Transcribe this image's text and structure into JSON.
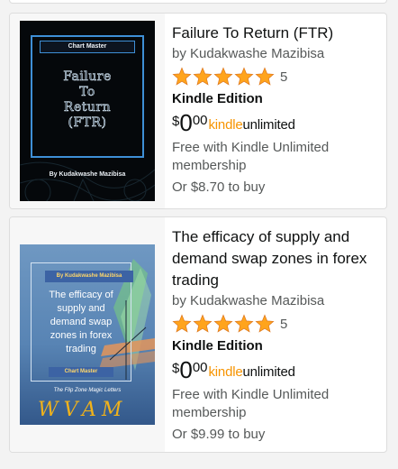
{
  "results": [
    {
      "title": "Failure To Return (FTR)",
      "author": "by Kudakwashe Mazibisa",
      "rating_count": "5",
      "rating_value": 5,
      "edition": "Kindle Edition",
      "price": {
        "currency": "$",
        "whole": "0",
        "fraction": "00"
      },
      "ku_logo": {
        "kindle": "kindle",
        "unlimited": "unlimited"
      },
      "offer_text": "Free with Kindle Unlimited membership",
      "buy_text": "Or $8.70 to buy",
      "cover": {
        "series": "Chart Master",
        "title_lines": [
          "Failure",
          "To",
          "Return",
          "(FTR)"
        ],
        "author": "By Kudakwashe Mazibisa"
      }
    },
    {
      "title": "The efficacy of supply and demand swap zones in forex trading",
      "author": "by Kudakwashe Mazibisa",
      "rating_count": "5",
      "rating_value": 5,
      "edition": "Kindle Edition",
      "price": {
        "currency": "$",
        "whole": "0",
        "fraction": "00"
      },
      "ku_logo": {
        "kindle": "kindle",
        "unlimited": "unlimited"
      },
      "offer_text": "Free with Kindle Unlimited membership",
      "buy_text": "Or $9.99 to buy",
      "cover": {
        "author_tag": "By Kudakwashe Mazibisa",
        "title_lines": [
          "The efficacy of",
          "supply and",
          "demand swap",
          "zones in forex",
          "trading"
        ],
        "series": "Chart Master",
        "tagline": "The Flip Zone Magic Letters",
        "magic_letters": "WVAM"
      }
    }
  ],
  "colors": {
    "page_bg": "#f3f3f3",
    "star": "#ffa41c",
    "kindle_orange": "#f79400",
    "secondary_text": "#565959"
  },
  "icons": {
    "rating_star": "star-icon"
  }
}
